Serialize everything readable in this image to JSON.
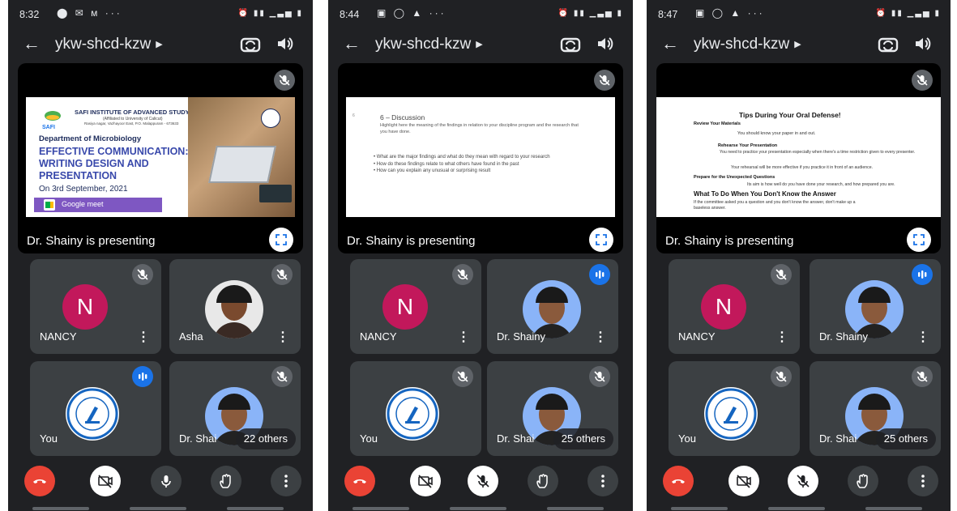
{
  "colors": {
    "bg": "#202124",
    "tile": "#3c4043",
    "end_call": "#ea4335",
    "accent": "#1a73e8",
    "avatar_nancy": "#c2185b"
  },
  "phones": [
    {
      "time": "8:32",
      "meeting_code": "ykw-shcd-kzw",
      "presenting_label": "Dr. Shainy is presenting",
      "slide": {
        "institute": "SAFI INSTITUTE OF ADVANCED STUDY",
        "affiliation": "(Affiliated to University of Calicut)",
        "address": "Rasiya nagar, Vazhayoor East, P.O. Malappuram - 673633",
        "logo_text": "SAFI",
        "department": "Department of Microbiology",
        "heading_1": "EFFECTIVE COMMUNICATION:",
        "heading_2": "WRITING DESIGN AND",
        "heading_3": "PRESENTATION",
        "date": "On 3rd September, 2021",
        "platform": "Google meet"
      },
      "tiles": [
        {
          "name": "NANCY",
          "initial": "N"
        },
        {
          "name": "Asha"
        },
        {
          "name": "You"
        },
        {
          "name": "Dr. Shai"
        }
      ],
      "others": "22 others"
    },
    {
      "time": "8:44",
      "meeting_code": "ykw-shcd-kzw",
      "presenting_label": "Dr. Shainy is presenting",
      "slide": {
        "number": "6",
        "heading": "6 – Discussion",
        "intro": "Highlight here the meaning of the findings in relation to your discipline program and the research that you have done.",
        "bullets": [
          "What are the major findings and what do they mean with regard to your research",
          "How do these findings relate to what others have found in the past",
          "How can you explain any unusual or surprising result"
        ]
      },
      "tiles": [
        {
          "name": "NANCY",
          "initial": "N"
        },
        {
          "name": "Dr. Shainy"
        },
        {
          "name": "You"
        },
        {
          "name": "Dr. Shai"
        }
      ],
      "others": "25 others"
    },
    {
      "time": "8:47",
      "meeting_code": "ykw-shcd-kzw",
      "presenting_label": "Dr. Shainy is presenting",
      "slide": {
        "heading": "Tips During Your Oral Defense!",
        "s1": "Review Your Materials",
        "s1_text": "You should know your paper in and out.",
        "s2": "Rehearse Your Presentation",
        "s2_text": "You need to practice your presentation especially when there's a time restriction given to every presenter.",
        "s2_text2": "Your rehearsal will be more effective if you practice it in front of an audience.",
        "s3": "Prepare for the Unexpected Questions",
        "s3_text": "Its aim is how well do you have done your research, and how prepared you are.",
        "s4": "What To Do When You Don't Know the Answer",
        "s4_text": "If the committee asked you a question and you don't know the answer, don't make up a baseless answer."
      },
      "tiles": [
        {
          "name": "NANCY",
          "initial": "N"
        },
        {
          "name": "Dr. Shainy"
        },
        {
          "name": "You"
        },
        {
          "name": "Dr. Shai"
        }
      ],
      "others": "25 others"
    }
  ]
}
